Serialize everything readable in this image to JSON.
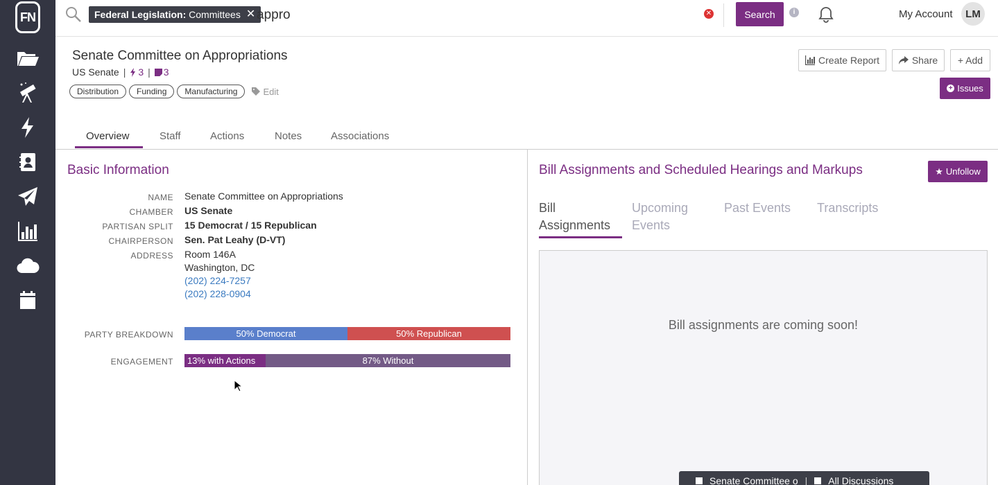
{
  "sidebar": {
    "logo": "FN",
    "items": [
      "folder-icon",
      "telescope-icon",
      "bolt-icon",
      "contacts-icon",
      "send-icon",
      "chart-icon",
      "cloud-icon",
      "calendar-icon"
    ]
  },
  "search": {
    "filter_label_bold": "Federal Legislation:",
    "filter_label": "Committees",
    "query": "appro",
    "button": "Search"
  },
  "account": {
    "label": "My Account",
    "initials": "LM"
  },
  "header": {
    "title": "Senate Committee on Appropriations",
    "chamber": "US Senate",
    "actions_count": "3",
    "notes_count": "3",
    "tags": [
      "Distribution",
      "Funding",
      "Manufacturing"
    ],
    "edit": "Edit",
    "create_report": "Create Report",
    "share": "Share",
    "add": "+ Add",
    "issues": "Issues"
  },
  "tabs": [
    "Overview",
    "Staff",
    "Actions",
    "Notes",
    "Associations"
  ],
  "basic_info": {
    "title": "Basic Information",
    "rows": [
      {
        "label": "NAME",
        "value": "Senate Committee on Appropriations"
      },
      {
        "label": "CHAMBER",
        "value": "US Senate"
      },
      {
        "label": "PARTISAN SPLIT",
        "value": "15 Democrat / 15 Republican"
      },
      {
        "label": "CHAIRPERSON",
        "value": "Sen. Pat Leahy (D-VT)"
      },
      {
        "label": "ADDRESS",
        "value": "Room 146A"
      }
    ],
    "address_line2": "Washington, DC",
    "phone1": "(202) 224-7257",
    "phone2": "(202) 228-0904",
    "party_label": "PARTY BREAKDOWN",
    "party": {
      "democrat_pct": 50,
      "democrat_label": "50% Democrat",
      "republican_label": "50% Republican"
    },
    "engagement_label": "ENGAGEMENT",
    "engagement": {
      "with_pct": 13,
      "with_label": "13% with Actions",
      "without_label": "87% Without"
    },
    "colors": {
      "democrat": "#5a7fcb",
      "republican": "#cf5050",
      "with": "#7b2e83",
      "without": "#735a86"
    }
  },
  "bill_panel": {
    "title": "Bill Assignments and Scheduled Hearings and Markups",
    "unfollow": "Unfollow",
    "subtabs": [
      {
        "line1": "Bill",
        "line2": "Assignments"
      },
      {
        "line1": "Upcoming",
        "line2": "Events"
      },
      {
        "line1": "Past Events",
        "line2": ""
      },
      {
        "line1": "Transcripts",
        "line2": ""
      }
    ],
    "placeholder": "Bill assignments are coming soon!"
  },
  "bottom_bar": {
    "item1": "Senate Committee o",
    "item2": "All Discussions"
  }
}
